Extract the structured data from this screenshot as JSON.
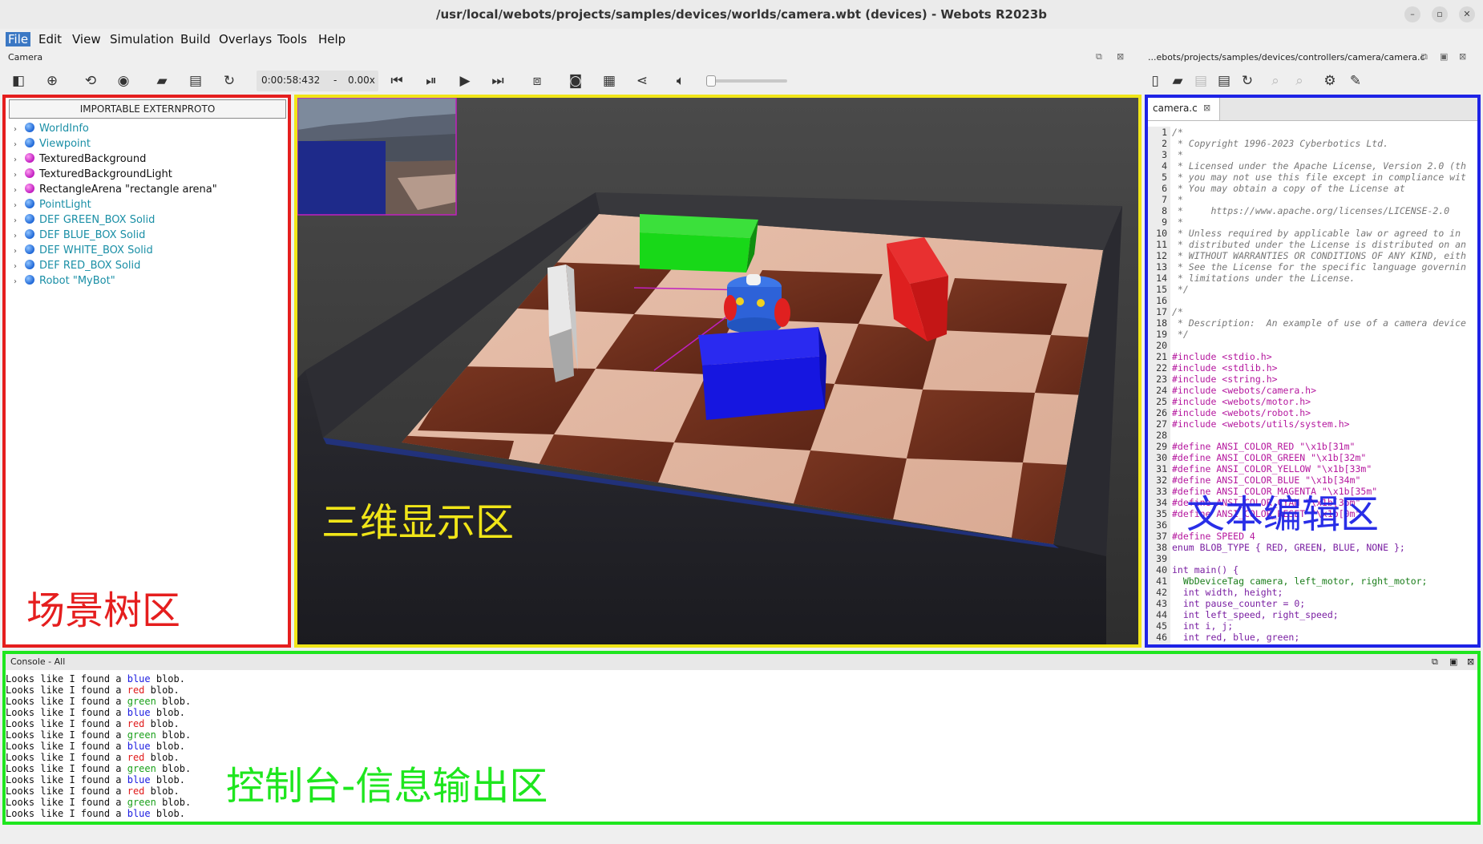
{
  "window": {
    "title": "/usr/local/webots/projects/samples/devices/worlds/camera.wbt (devices) - Webots R2023b",
    "controls": [
      "–",
      "▫",
      "✕"
    ]
  },
  "menubar": {
    "items": [
      "File",
      "Edit",
      "View",
      "Simulation",
      "Build",
      "Overlays",
      "Tools",
      "Help"
    ],
    "active": "File"
  },
  "left_panel_title": "Camera",
  "right_panel_title": "...ebots/projects/samples/devices/controllers/camera/camera.c",
  "toolbar": {
    "sim_time": "0:00:58:432",
    "speed_sep": "-",
    "speed": "0.00x",
    "volume_level": 0.0
  },
  "scene_tree": {
    "import_button": "IMPORTABLE EXTERNPROTO",
    "nodes": [
      {
        "label": "WorldInfo",
        "ball": "blue",
        "style": "cyan"
      },
      {
        "label": "Viewpoint",
        "ball": "blue",
        "style": "cyan"
      },
      {
        "label": "TexturedBackground",
        "ball": "magenta",
        "style": "dark"
      },
      {
        "label": "TexturedBackgroundLight",
        "ball": "magenta",
        "style": "dark"
      },
      {
        "label": "RectangleArena \"rectangle arena\"",
        "ball": "magenta",
        "style": "dark"
      },
      {
        "label": "PointLight",
        "ball": "blue",
        "style": "cyan"
      },
      {
        "label": "DEF GREEN_BOX Solid",
        "ball": "blue",
        "style": "cyan"
      },
      {
        "label": "DEF BLUE_BOX Solid",
        "ball": "blue",
        "style": "cyan"
      },
      {
        "label": "DEF WHITE_BOX Solid",
        "ball": "blue",
        "style": "cyan"
      },
      {
        "label": "DEF RED_BOX Solid",
        "ball": "blue",
        "style": "cyan"
      },
      {
        "label": "Robot \"MyBot\"",
        "ball": "blue",
        "style": "cyan"
      }
    ],
    "annotation": "场景树区",
    "annotation_color": "#e51e1e"
  },
  "view3d": {
    "annotation": "三维显示区",
    "annotation_color": "#f0e518"
  },
  "editor": {
    "tab": "camera.c",
    "tab_close": "⊠",
    "annotation": "文本编辑区",
    "annotation_color": "#1e23e6",
    "lines": [
      {
        "n": "1",
        "t": "/*",
        "c": "com"
      },
      {
        "n": "2",
        "t": " * Copyright 1996-2023 Cyberbotics Ltd.",
        "c": "com"
      },
      {
        "n": "3",
        "t": " *",
        "c": "com"
      },
      {
        "n": "4",
        "t": " * Licensed under the Apache License, Version 2.0 (th",
        "c": "com"
      },
      {
        "n": "5",
        "t": " * you may not use this file except in compliance wit",
        "c": "com"
      },
      {
        "n": "6",
        "t": " * You may obtain a copy of the License at",
        "c": "com"
      },
      {
        "n": "7",
        "t": " *",
        "c": "com"
      },
      {
        "n": "8",
        "t": " *     https://www.apache.org/licenses/LICENSE-2.0",
        "c": "com"
      },
      {
        "n": "9",
        "t": " *",
        "c": "com"
      },
      {
        "n": "10",
        "t": " * Unless required by applicable law or agreed to in",
        "c": "com"
      },
      {
        "n": "11",
        "t": " * distributed under the License is distributed on an",
        "c": "com"
      },
      {
        "n": "12",
        "t": " * WITHOUT WARRANTIES OR CONDITIONS OF ANY KIND, eith",
        "c": "com"
      },
      {
        "n": "13",
        "t": " * See the License for the specific language governin",
        "c": "com"
      },
      {
        "n": "14",
        "t": " * limitations under the License.",
        "c": "com"
      },
      {
        "n": "15",
        "t": " */",
        "c": "com"
      },
      {
        "n": "16",
        "t": "",
        "c": "norm"
      },
      {
        "n": "17",
        "t": "/*",
        "c": "com"
      },
      {
        "n": "18",
        "t": " * Description:  An example of use of a camera device",
        "c": "com"
      },
      {
        "n": "19",
        "t": " */",
        "c": "com"
      },
      {
        "n": "20",
        "t": "",
        "c": "norm"
      },
      {
        "n": "21",
        "t": "#include <stdio.h>",
        "c": "pre"
      },
      {
        "n": "22",
        "t": "#include <stdlib.h>",
        "c": "pre"
      },
      {
        "n": "23",
        "t": "#include <string.h>",
        "c": "pre"
      },
      {
        "n": "24",
        "t": "#include <webots/camera.h>",
        "c": "pre"
      },
      {
        "n": "25",
        "t": "#include <webots/motor.h>",
        "c": "pre"
      },
      {
        "n": "26",
        "t": "#include <webots/robot.h>",
        "c": "pre"
      },
      {
        "n": "27",
        "t": "#include <webots/utils/system.h>",
        "c": "pre"
      },
      {
        "n": "28",
        "t": "",
        "c": "norm"
      },
      {
        "n": "29",
        "t": "#define ANSI_COLOR_RED \"\\x1b[31m\"",
        "c": "def"
      },
      {
        "n": "30",
        "t": "#define ANSI_COLOR_GREEN \"\\x1b[32m\"",
        "c": "def"
      },
      {
        "n": "31",
        "t": "#define ANSI_COLOR_YELLOW \"\\x1b[33m\"",
        "c": "def"
      },
      {
        "n": "32",
        "t": "#define ANSI_COLOR_BLUE \"\\x1b[34m\"",
        "c": "def"
      },
      {
        "n": "33",
        "t": "#define ANSI_COLOR_MAGENTA \"\\x1b[35m\"",
        "c": "def"
      },
      {
        "n": "34",
        "t": "#define ANSI_COLOR_CYAN \"\\x1b[36m\"",
        "c": "def"
      },
      {
        "n": "35",
        "t": "#define ANSI_COLOR_RESET \"\\x1b[0m\"",
        "c": "def"
      },
      {
        "n": "36",
        "t": "",
        "c": "norm"
      },
      {
        "n": "37",
        "t": "#define SPEED 4",
        "c": "def"
      },
      {
        "n": "38",
        "t": "enum BLOB_TYPE { RED, GREEN, BLUE, NONE };",
        "c": "kw"
      },
      {
        "n": "39",
        "t": "",
        "c": "norm"
      },
      {
        "n": "40",
        "t": "int main() {",
        "c": "kw"
      },
      {
        "n": "41",
        "t": "  WbDeviceTag camera, left_motor, right_motor;",
        "c": "fn"
      },
      {
        "n": "42",
        "t": "  int width, height;",
        "c": "kw"
      },
      {
        "n": "43",
        "t": "  int pause_counter = 0;",
        "c": "kw"
      },
      {
        "n": "44",
        "t": "  int left_speed, right_speed;",
        "c": "kw"
      },
      {
        "n": "45",
        "t": "  int i, j;",
        "c": "kw"
      },
      {
        "n": "46",
        "t": "  int red, blue, green;",
        "c": "kw"
      }
    ]
  },
  "console": {
    "title": "Console - All",
    "annotation": "控制台-信息输出区",
    "annotation_color": "#1ee61e",
    "prefix": "Looks like I found a ",
    "suffix": " blob.",
    "lines": [
      "blue",
      "red",
      "green",
      "blue",
      "red",
      "green",
      "blue",
      "red",
      "green",
      "blue",
      "red",
      "green",
      "blue"
    ]
  }
}
